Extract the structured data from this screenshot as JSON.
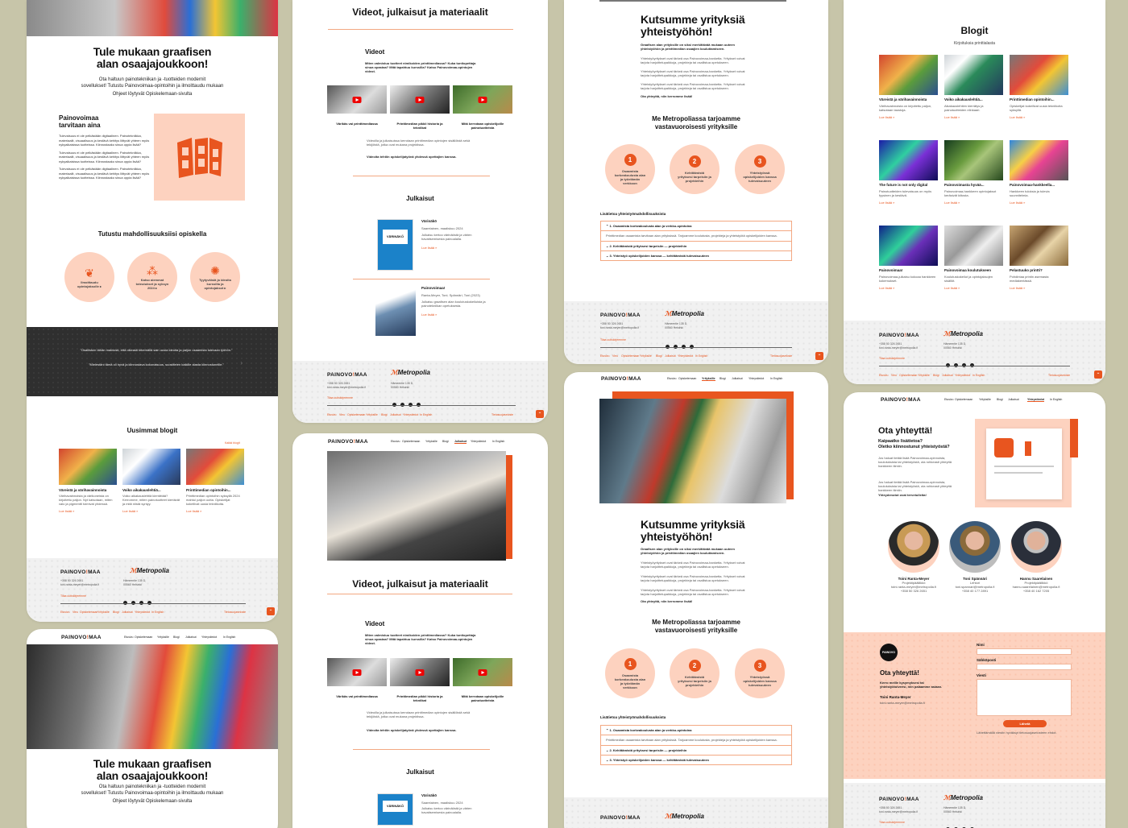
{
  "colors": {
    "accent": "#e8551f",
    "peach": "#fdd2bf",
    "dark": "#2f2f2f",
    "footer": "#f1f1f1"
  },
  "brand": {
    "logo_a": "PAINOVO",
    "logo_b": "!",
    "logo_c": "MAA",
    "partner": "Metropolia"
  },
  "footer": {
    "phone": "+358 50 326 2651",
    "email": "toni.ranta-meyer@metropolia.fi",
    "addr1": "Hämeentie 135 D,",
    "addr2": "00560 Helsinki",
    "subscribe": "Tilaa uutiskirjeemme",
    "links": [
      "Etusivu",
      "Vieu",
      "Opiskelemaan",
      "Yrityksille",
      "Blogi",
      "Julkaisut",
      "Yhteystiedot",
      "In English"
    ],
    "privacy": "Tietosuojaseloste",
    "up": "⌃"
  },
  "nav": {
    "items": [
      "Etusivu",
      "Opiskelemaan",
      "Yrityksille",
      "Blogi",
      "Julkaisut",
      "Yhteystiedot",
      "In English"
    ]
  },
  "p1": {
    "title1": "Tule mukaan graafisen",
    "title2": "alan osaajajoukkoon!",
    "lead1": "Ota haltuun painotekniikan ja -tuotteiden modernit",
    "lead2": "sovellukset! Tutustu Painovoimaa-opintoihin ja ilmoittaudu mukaan",
    "lead3": "Ohjeet löytyvät Opiskelemaan-sivulta",
    "need_title1": "Painovoimaa",
    "need_title2": "tarvitaan aina",
    "need_text": "Tulevaisuus ei ole pelkästään digitaalinen. Painotekniikka, materiaalit, visuaalisuus ja kestävä kehitys liittyvät yhteen myös nykyaikaisissa tuotteissa. Kiinnostaako sinua oppia lisää?",
    "explore": "Tutustu mahdollisuuksiisi opiskella",
    "circles": [
      "Ilmoittaudu opintojaksolle ▸",
      "Katso aiemmat toteutukset ja syksyn 2024 ▸",
      "Tyytyväisiä ja ideoita kurssilta ja opintojaksot ▸"
    ],
    "quote1": "”Osallistuin tähän mainiosti, että oikeasti tekemällä sain uusia ideoita ja paljon osaamista tulevaan työhön.”",
    "quote2": "”Mielestäni tämä oli hyvä ja kiinnostava kokonaisuus, suosittelen kaikille alasta kiinnostuneille.”",
    "blogs_title": "Uusimmat blogit",
    "blogs_all": "Kaikki blogit",
    "blogs": [
      {
        "title": "Väreistä ja värihavainnoista",
        "text": "Värihavainnoista ja värikoneista on kirjoitettu paljon. Nyt katsotaan, miten valo ja pigmentti toimivat yhdessä.",
        "more": "Lue lisää »"
      },
      {
        "title": "Voiko aikakauslehtiä...",
        "text": "Voiko aikakauslehtiä kierrättää? Kerromme, miten painotuotteet kiertävät ja mitä niistä syntyy.",
        "more": "Lue lisää »"
      },
      {
        "title": "Printtimedian opintoihin...",
        "text": "Printtimedian opintoihin syksyllä 2024 mahtui paljon uutta. Opiskelijat kokeilivat uusia tekniikoita.",
        "more": "Lue lisää »"
      }
    ]
  },
  "p2": {
    "title": "Videot, julkaisut ja materiaalit",
    "videos_title": "Videot",
    "videos_lead": "Miten valmistuu tuotteet nimikoiden printtimediassa? Kuka tuntiopettaja sinua opastaa? Mitä tapahtuu kurssilla? Katso Painovoimaa-opintojen videot.",
    "videos": [
      "Värikäs vai printtimediassa",
      "Printtimedian pikkii historia ja tekniikat",
      "Mitä kerrotaan opiskelijoille painotuotteista"
    ],
    "body": "Videoilla ja julkaisuissa kerrotaan printtimedian opintojen sisällöistä sekä tekijöistä, jotka ovat mukana projektissa.",
    "body2": "Videoita tehtiin opiskelijatyönä yhdessä opettajien kanssa.",
    "pubs_title": "Julkaisut",
    "pubs": [
      {
        "title": "Värinäkö",
        "meta": "Saarelainen, maaliskuu 2024",
        "text": "Julkaisu kertoo värinäöstä ja värien havaitsemisesta painoalalla.",
        "more": "Lue lisää »",
        "cover": "VÄRINÄKÖ"
      },
      {
        "title": "Painovoimaa!",
        "meta": "Ranta-Meyer, Toni; Spännäri, Toni (2023)",
        "text": "Julkaisu graafisen alan koulutuskokeiluista ja painotekniikan opetuksesta.",
        "more": "Lue lisää »",
        "cover": "Painovoimaa"
      }
    ]
  },
  "p3": {
    "title1": "Kutsumme yrityksiä",
    "title2": "yhteistyöhön!",
    "lead": "Graafisen alan yrityksille on siksi merkittävää mukaan uuteen yhteistyöhön ja printtimedian osaajien kouluttamiseen.",
    "text": "Yhteistyöyritykset ovat tärkeä osa Painovoimaa-hanketta. Yritykset voivat tarjota harjoittelupaikkoja, projekteja tai osallistua opetukseen.",
    "contact": "Ota yhteyttä, niin kerromme lisää!",
    "offer1": "Me Metropoliassa tarjoamme",
    "offer2": "vastavuoroisesti yrityksille",
    "steps": [
      {
        "n": "1",
        "t": "Osaamista korkeakoulusta alan ja työelämän verkkoon"
      },
      {
        "n": "2",
        "t": "Kehittämistä yrityksesi tarpeisiin ja projekteihin"
      },
      {
        "n": "3",
        "t": "Yhteistyössä opiskelijoiden kanssa tulevaisuuteen"
      }
    ],
    "more_title": "Lisätietoa yhteistyömahdollisuuksista",
    "acc": [
      "1. Osaamista korkeakoulusta alan ja verkko-opintoina",
      "2. Kehittämistä yrityksesi tarpeisiin — projekteihin",
      "3. Yhteistyö opiskelijoiden kanssa — kehittämistä tulevaisuuteen"
    ],
    "acc_text": "Printtimedian osaamista tarvitaan alan yrityksissä. Tarjoamme koulutusta, projekteja ja yhteistyötä opiskelijoiden kanssa."
  },
  "p4": {
    "title": "Blogit",
    "sub": "Kirjoituksia printtialasta",
    "posts": [
      {
        "t": "Väreistä ja värihavainnoista",
        "x": "Värihavainnoista on kirjoitettu paljon, katsotaan taustoja.",
        "m": "Lue lisää »"
      },
      {
        "t": "Voiko aikakauslehtiä...",
        "x": "Aikakauslehtien kierrätys ja painotuotteiden elinkaari.",
        "m": "Lue lisää »"
      },
      {
        "t": "Printtimedian opintoihin...",
        "x": "Opiskelijat kokeilivat uusia tekniikoita syksyllä.",
        "m": "Lue lisää »"
      },
      {
        "t": "The future is not only digital",
        "x": "Painotuotteiden tulevaisuus on myös fyysinen ja kestävä.",
        "m": "Lue lisää »"
      },
      {
        "t": "Painovoimasta hyvää...",
        "x": "Painovoimaa-hankkeen opintojaksot keräsivät kiitosta.",
        "m": "Lue lisää »"
      },
      {
        "t": "Painovoimaa-hankkeella...",
        "x": "Hankkeen tuloksia ja tulevia suunnitelmia.",
        "m": "Lue lisää »"
      },
      {
        "t": "Painovoimaa!",
        "x": "Painovoimaa-julkaisu kokoaa hankkeen kokemukset.",
        "m": "Lue lisää »"
      },
      {
        "t": "Painovoimaa koulutukseen",
        "x": "Koulutuskokeilut ja opintojaksojen sisällöt.",
        "m": "Lue lisää »"
      },
      {
        "t": "Pelastuuko printti?",
        "x": "Pohdintaa printin asemasta mediakentässä.",
        "m": "Lue lisää »"
      }
    ]
  },
  "p5": {
    "title1": "Ota yhteyttä!",
    "sub1": "Kaipaatko lisätietoa?",
    "sub2": "Oletko kiinnostunut yhteistyöstä?",
    "text": "Jos haluat tietää lisää Painovoimaa-opinnoista, koulutuksista tai yhteistyöstä, ota rohkeasti yhteyttä hankkeen tiimiin.",
    "welcome": "Yhteydenotot ovat tervetulleita!",
    "people": [
      {
        "name": "Toini Ranta-Meyer",
        "role": "Projektipäällikkö",
        "email": "toini.ranta-meyer@metropolia.fi",
        "phone": "+358 50 326 2651"
      },
      {
        "name": "Toni Spännäri",
        "role": "Lehtori",
        "email": "toni.spannari@metropolia.fi",
        "phone": "+358 40 177 2891"
      },
      {
        "name": "Hannu Saarelainen",
        "role": "Projektipäällikkö",
        "email": "hannu.saarelainen@metropolia.fi",
        "phone": "+358 40 162 7205"
      }
    ],
    "form_title": "Ota yhteyttä!",
    "form_text": "Kerro meille kysymyksesi tai yhteistyötoiveesi, niin palaamme asiaan.",
    "form_person": "Toini Ranta-Meyer",
    "form_email": "toini.ranta-meyer@metropolia.fi",
    "f_name": "Nimi",
    "f_email": "Sähköposti",
    "f_msg": "Viesti",
    "send": "Lähetä",
    "consent": "Lähettämällä viestin hyväksyt tietosuojaselosteen ehdot."
  }
}
